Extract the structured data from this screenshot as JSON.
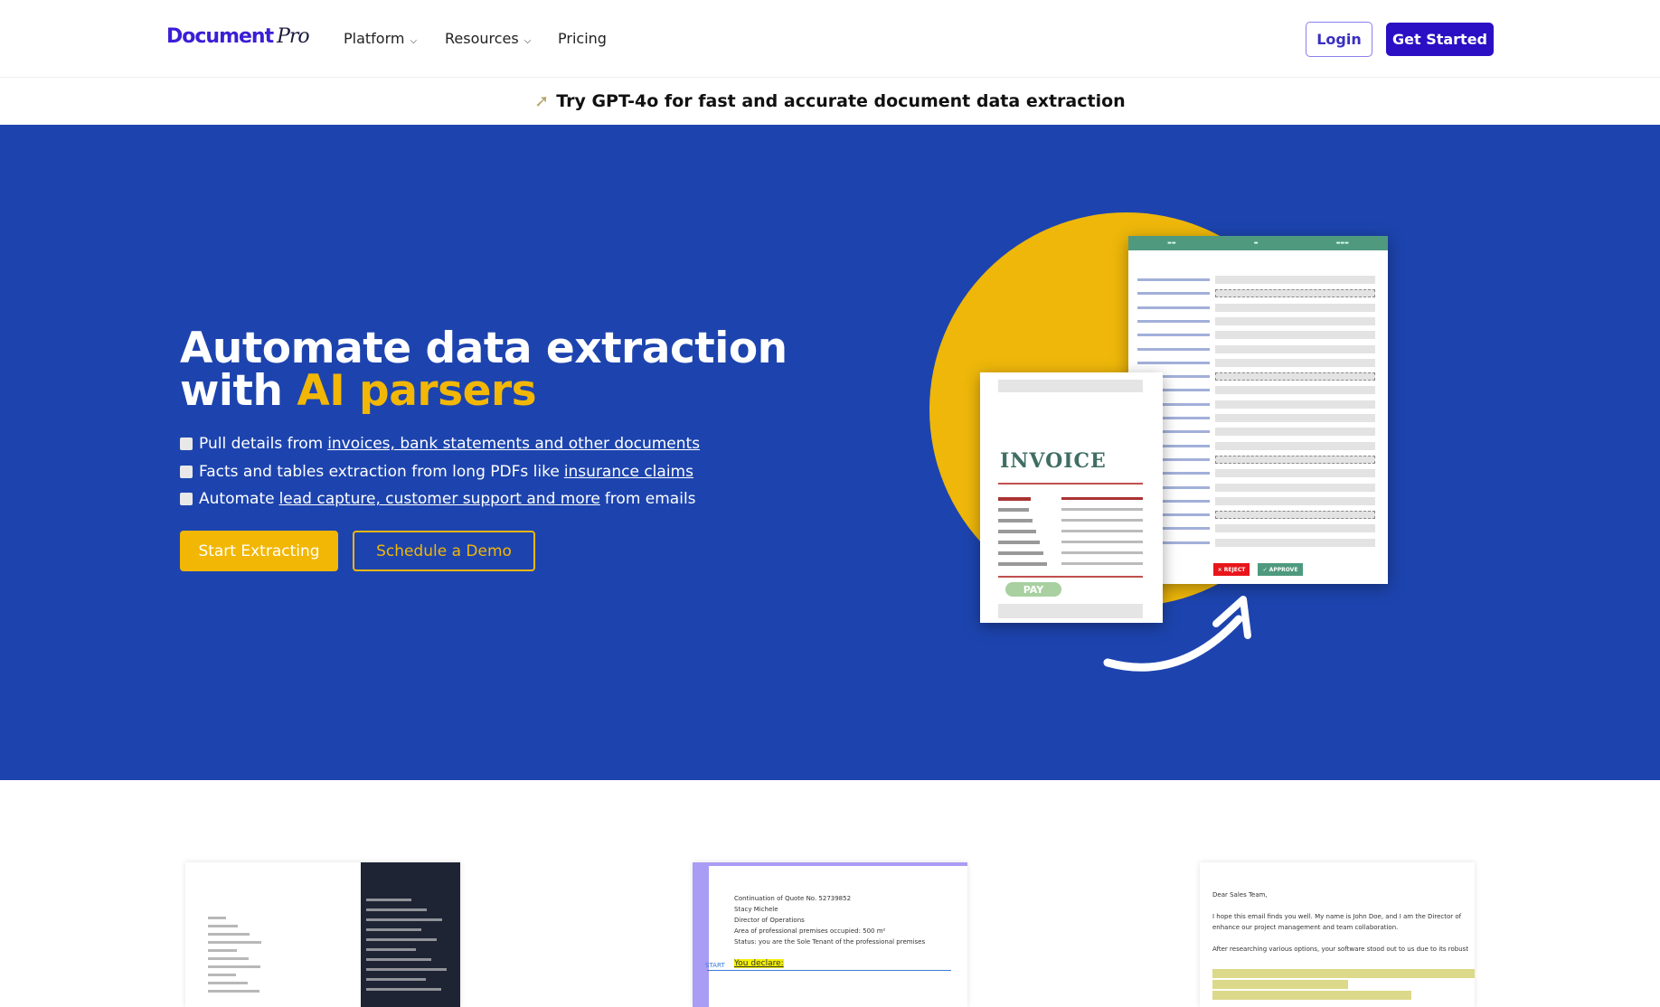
{
  "nav": {
    "logo": "Document",
    "logo_script": "Pro",
    "items": [
      {
        "label": "Platform",
        "dropdown": true
      },
      {
        "label": "Resources",
        "dropdown": true
      },
      {
        "label": "Pricing",
        "dropdown": false
      }
    ],
    "login": "Login",
    "get_started": "Get Started"
  },
  "banner": {
    "icon": "magic-wand-icon",
    "text": "Try GPT-4o for fast and accurate document data extraction"
  },
  "hero": {
    "title_line1": "Automate data extraction",
    "title_line2_prefix": "with ",
    "title_highlight": "AI parsers",
    "bullets": [
      {
        "icon": "receipt-icon",
        "pre": "Pull details from",
        "link": "invoices, bank statements and other documents",
        "post": ""
      },
      {
        "icon": "book-icon",
        "pre": "Facts and tables extraction from long PDFs like",
        "link": "insurance claims",
        "post": ""
      },
      {
        "icon": "envelope-icon",
        "pre": "Automate",
        "link": "lead capture, customer support and more",
        "post": "from emails"
      }
    ],
    "start_button": "Start Extracting",
    "demo_button": "Schedule a Demo",
    "illustration": {
      "invoice_title": "INVOICE",
      "pay_label": "PAY",
      "reject_label": "× REJECT",
      "approve_label": "✓ APPROVE"
    }
  },
  "colors": {
    "brand": "#2b0fc4",
    "hero_bg": "#1d44ae",
    "accent": "#f2b705",
    "panel_green": "#4f9a7f",
    "reject_red": "#e8161b"
  },
  "cards": [
    {
      "type": "invoice-json"
    },
    {
      "type": "pdf",
      "lines": [
        "Continuation of Quote No. 52739852",
        "Stacy Michele",
        "Director of Operations",
        "Area of professional premises occupied: 500 m²",
        "Status: you are the Sole Tenant of the professional premises"
      ],
      "marker": "START",
      "highlight": "You declare:"
    },
    {
      "type": "email",
      "lines": [
        "Dear Sales Team,",
        "I hope this email finds you well. My name is John Doe, and I am the Director of",
        "enhance our project management and team collaboration.",
        "After researching various options, your software stood out to us due to its robust"
      ]
    }
  ]
}
